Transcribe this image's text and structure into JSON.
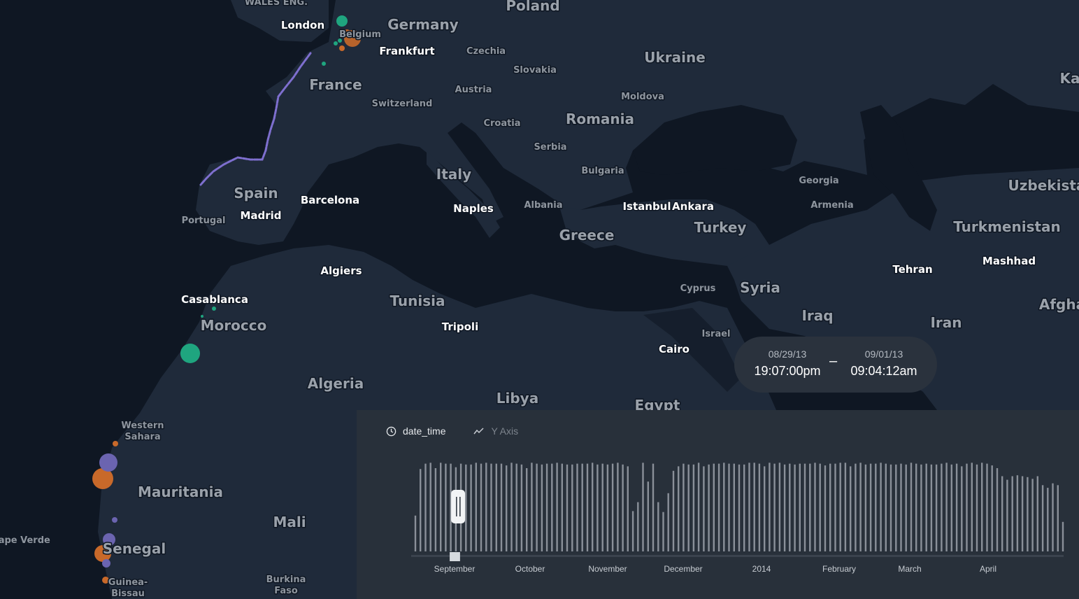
{
  "map": {
    "countries": [
      {
        "name": "Poland",
        "cls": "country-lg"
      },
      {
        "name": "Germany",
        "cls": "country-lg"
      },
      {
        "name": "Ukraine",
        "cls": "country-lg"
      },
      {
        "name": "France",
        "cls": "country-lg"
      },
      {
        "name": "Romania",
        "cls": "country-lg"
      },
      {
        "name": "Italy",
        "cls": "country-lg"
      },
      {
        "name": "Spain",
        "cls": "country-lg"
      },
      {
        "name": "Greece",
        "cls": "country-lg"
      },
      {
        "name": "Turkey",
        "cls": "country-lg"
      },
      {
        "name": "Syria",
        "cls": "country-lg"
      },
      {
        "name": "Iraq",
        "cls": "country-lg"
      },
      {
        "name": "Iran",
        "cls": "country-lg"
      },
      {
        "name": "Tunisia",
        "cls": "country-lg"
      },
      {
        "name": "Morocco",
        "cls": "country-lg"
      },
      {
        "name": "Algeria",
        "cls": "country-lg"
      },
      {
        "name": "Libya",
        "cls": "country-lg"
      },
      {
        "name": "Egypt",
        "cls": "country-lg"
      },
      {
        "name": "Mauritania",
        "cls": "country-lg"
      },
      {
        "name": "Mali",
        "cls": "country-lg"
      },
      {
        "name": "Senegal",
        "cls": "country-lg"
      },
      {
        "name": "Uzbekista",
        "cls": "country-lg"
      },
      {
        "name": "Turkmenistan",
        "cls": "country-lg"
      },
      {
        "name": "Afgha",
        "cls": "country-lg"
      },
      {
        "name": "Ka",
        "cls": "country-lg"
      },
      {
        "name": "Czechia",
        "cls": "country-sm"
      },
      {
        "name": "Slovakia",
        "cls": "country-sm"
      },
      {
        "name": "Austria",
        "cls": "country-sm"
      },
      {
        "name": "Moldova",
        "cls": "country-sm"
      },
      {
        "name": "Switzerland",
        "cls": "country-sm"
      },
      {
        "name": "Croatia",
        "cls": "country-sm"
      },
      {
        "name": "Serbia",
        "cls": "country-sm"
      },
      {
        "name": "Bulgaria",
        "cls": "country-sm"
      },
      {
        "name": "Albania",
        "cls": "country-sm"
      },
      {
        "name": "Georgia",
        "cls": "country-sm"
      },
      {
        "name": "Armenia",
        "cls": "country-sm"
      },
      {
        "name": "Portugal",
        "cls": "country-sm"
      },
      {
        "name": "Cyprus",
        "cls": "country-sm"
      },
      {
        "name": "Israel",
        "cls": "country-sm"
      },
      {
        "name": "Belgium",
        "cls": "country-sm"
      },
      {
        "name": "Western",
        "cls": "country-sm"
      },
      {
        "name": "Sahara",
        "cls": "country-sm"
      },
      {
        "name": "Cape Verde",
        "cls": "country-sm"
      },
      {
        "name": "Guinea-",
        "cls": "country-sm"
      },
      {
        "name": "Bissau",
        "cls": "country-sm"
      },
      {
        "name": "Burkina",
        "cls": "country-sm"
      },
      {
        "name": "Faso",
        "cls": "country-sm"
      },
      {
        "name": "WALES ENG.",
        "cls": "country-sm"
      }
    ],
    "cities": [
      "London",
      "Frankfurt",
      "Barcelona",
      "Madrid",
      "Naples",
      "Istanbul",
      "Ankara",
      "Algiers",
      "Casablanca",
      "Tripoli",
      "Cairo",
      "Tehran",
      "Mashhad"
    ],
    "colors": {
      "land": "#1f2a3a",
      "water": "#0f1723",
      "path": "#7e6fcf",
      "teal": "#1fa57f",
      "orange": "#c8692a",
      "purple": "#6b64b0"
    }
  },
  "time_range": {
    "start_date": "08/29/13",
    "start_time": "19:07:00pm",
    "end_date": "09/01/13",
    "end_time": "09:04:12am",
    "separator": "–"
  },
  "timeline": {
    "x_field": "date_time",
    "y_label": "Y Axis",
    "clock_icon": "clock-icon",
    "chart_icon": "line-chart-icon",
    "ticks": [
      "September",
      "October",
      "November",
      "December",
      "2014",
      "February",
      "March",
      "April"
    ],
    "histogram": [
      0.4,
      0.92,
      0.98,
      0.99,
      0.93,
      0.99,
      0.98,
      0.98,
      0.94,
      0.98,
      0.97,
      0.97,
      0.99,
      0.98,
      0.99,
      0.98,
      0.98,
      0.98,
      0.96,
      0.99,
      0.98,
      0.97,
      0.93,
      0.99,
      0.98,
      0.97,
      0.98,
      0.98,
      0.99,
      0.98,
      0.97,
      0.97,
      0.98,
      0.98,
      0.98,
      0.99,
      0.97,
      0.98,
      0.97,
      0.98,
      0.99,
      0.97,
      0.95,
      0.45,
      0.55,
      0.99,
      0.78,
      0.98,
      0.55,
      0.44,
      0.65,
      0.9,
      0.95,
      0.98,
      0.97,
      0.97,
      0.99,
      0.95,
      0.97,
      0.98,
      0.98,
      0.99,
      0.98,
      0.98,
      0.97,
      0.97,
      0.99,
      0.99,
      0.98,
      0.95,
      0.99,
      0.98,
      0.99,
      0.97,
      0.98,
      0.97,
      0.98,
      0.98,
      0.98,
      0.99,
      0.98,
      0.96,
      0.98,
      0.98,
      0.99,
      0.99,
      0.95,
      0.98,
      0.99,
      0.97,
      0.98,
      0.98,
      0.99,
      0.98,
      0.97,
      0.97,
      0.98,
      0.97,
      0.99,
      0.98,
      0.97,
      0.98,
      0.97,
      0.97,
      0.98,
      0.99,
      0.97,
      0.98,
      0.95,
      0.98,
      0.99,
      0.97,
      0.99,
      0.98,
      0.96,
      0.93,
      0.84,
      0.8,
      0.84,
      0.85,
      0.84,
      0.83,
      0.81,
      0.84,
      0.74,
      0.71,
      0.76,
      0.74,
      0.33
    ],
    "brush": {
      "start": 0.053,
      "end": 0.069
    }
  }
}
